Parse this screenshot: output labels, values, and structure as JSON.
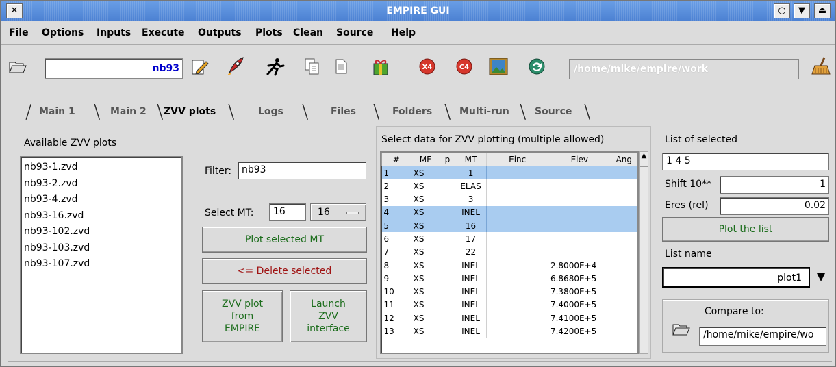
{
  "window": {
    "title": "EMPIRE GUI"
  },
  "menu": [
    "File",
    "Options",
    "Inputs",
    "Execute",
    "Outputs",
    "Plots",
    "Clean",
    "Source",
    "Help"
  ],
  "toolbar": {
    "project": "nb93",
    "workdir": "/home/mike/empire/work",
    "icons": [
      "open-folder-icon",
      "edit-icon",
      "rocket-icon",
      "runner-icon",
      "copy-icon",
      "document-icon",
      "gift-icon",
      "x4-icon",
      "c4-icon",
      "image-icon",
      "refresh-icon",
      "broom-icon"
    ]
  },
  "tabs": [
    "Main 1",
    "Main 2",
    "ZVV plots",
    "Logs",
    "Files",
    "Folders",
    "Multi-run",
    "Source"
  ],
  "left": {
    "title": "Available ZVV plots",
    "items": [
      "nb93-1.zvd",
      "nb93-2.zvd",
      "nb93-4.zvd",
      "nb93-16.zvd",
      "nb93-102.zvd",
      "nb93-103.zvd",
      "nb93-107.zvd"
    ]
  },
  "middle": {
    "filter_label": "Filter:",
    "filter_value": "nb93",
    "select_mt_label": "Select MT:",
    "select_mt_value": "16",
    "mt_option": "16",
    "plot_selected": "Plot  selected MT",
    "delete_selected": "<= Delete selected",
    "zvv_from_empire": [
      "ZVV plot",
      "from",
      "EMPIRE"
    ],
    "launch_zvv": [
      "Launch",
      "ZVV",
      "interface"
    ]
  },
  "table": {
    "title": "Select data for ZVV plotting (multiple allowed)",
    "headers": [
      "#",
      "MF",
      "p",
      "MT",
      "Einc",
      "Elev",
      "Ang"
    ],
    "rows": [
      {
        "n": "1",
        "mf": "XS",
        "p": "",
        "mt": "1",
        "einc": "",
        "elev": "",
        "ang": "",
        "sel": true
      },
      {
        "n": "2",
        "mf": "XS",
        "p": "",
        "mt": "ELAS",
        "einc": "",
        "elev": "",
        "ang": "",
        "sel": false
      },
      {
        "n": "3",
        "mf": "XS",
        "p": "",
        "mt": "3",
        "einc": "",
        "elev": "",
        "ang": "",
        "sel": false
      },
      {
        "n": "4",
        "mf": "XS",
        "p": "",
        "mt": "INEL",
        "einc": "",
        "elev": "",
        "ang": "",
        "sel": true
      },
      {
        "n": "5",
        "mf": "XS",
        "p": "",
        "mt": "16",
        "einc": "",
        "elev": "",
        "ang": "",
        "sel": true
      },
      {
        "n": "6",
        "mf": "XS",
        "p": "",
        "mt": "17",
        "einc": "",
        "elev": "",
        "ang": "",
        "sel": false
      },
      {
        "n": "7",
        "mf": "XS",
        "p": "",
        "mt": "22",
        "einc": "",
        "elev": "",
        "ang": "",
        "sel": false
      },
      {
        "n": "8",
        "mf": "XS",
        "p": "",
        "mt": "INEL",
        "einc": "",
        "elev": "2.8000E+4",
        "ang": "",
        "sel": false
      },
      {
        "n": "9",
        "mf": "XS",
        "p": "",
        "mt": "INEL",
        "einc": "",
        "elev": "6.8680E+5",
        "ang": "",
        "sel": false
      },
      {
        "n": "10",
        "mf": "XS",
        "p": "",
        "mt": "INEL",
        "einc": "",
        "elev": "7.3800E+5",
        "ang": "",
        "sel": false
      },
      {
        "n": "11",
        "mf": "XS",
        "p": "",
        "mt": "INEL",
        "einc": "",
        "elev": "7.4000E+5",
        "ang": "",
        "sel": false
      },
      {
        "n": "12",
        "mf": "XS",
        "p": "",
        "mt": "INEL",
        "einc": "",
        "elev": "7.4100E+5",
        "ang": "",
        "sel": false
      },
      {
        "n": "13",
        "mf": "XS",
        "p": "",
        "mt": "INEL",
        "einc": "",
        "elev": "7.4200E+5",
        "ang": "",
        "sel": false
      }
    ]
  },
  "right": {
    "list_title": "List of selected",
    "list_value": "1 4 5",
    "shift_label": "Shift 10**",
    "shift_value": "1",
    "eres_label": "Eres (rel)",
    "eres_value": "0.02",
    "plot_list": "Plot the list",
    "list_name_label": "List name",
    "list_name_value": "plot1",
    "compare_label": "Compare to:",
    "compare_value": "/home/mike/empire/wo"
  },
  "colors": {
    "title_bar": "#5a8fde",
    "selection": "#a9ccf0",
    "button_text": "#1c6d1c",
    "delete_text": "#a01515",
    "project_text": "#0000cc"
  }
}
